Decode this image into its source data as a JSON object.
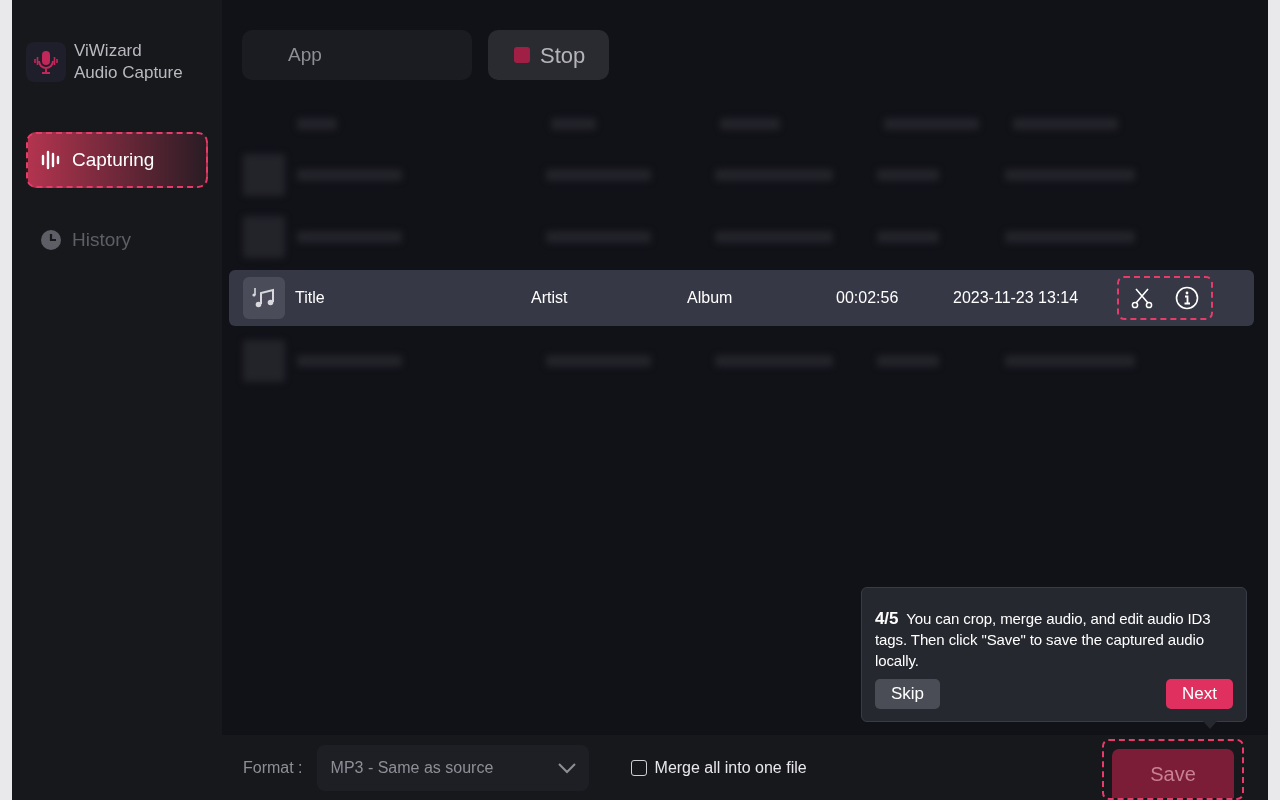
{
  "app": {
    "name_line1": "ViWizard",
    "name_line2": "Audio Capture"
  },
  "sidebar": {
    "items": [
      {
        "label": "Capturing",
        "kind": "bars",
        "selected": true,
        "highlighted": true
      },
      {
        "label": "History",
        "kind": "clock",
        "selected": false,
        "highlighted": false
      }
    ]
  },
  "toolbar": {
    "source": "App",
    "stop_button": "Stop"
  },
  "table": {
    "rows": [
      {
        "kind": "blurred"
      },
      {
        "kind": "blurred"
      },
      {
        "kind": "track",
        "title": "Title",
        "artist": "Artist",
        "album": "Album",
        "duration": "00:02:56",
        "date_added": "2023-11-23 13:14",
        "actions_highlighted": true
      },
      {
        "kind": "blurred"
      }
    ]
  },
  "tooltip": {
    "step": "4/5",
    "text": "You can crop, merge audio, and edit audio ID3 tags. Then click \"Save\" to save the captured audio locally.",
    "skip": "Skip",
    "next": "Next"
  },
  "footer": {
    "format_label": "Format :",
    "format_value": "MP3 - Same as source",
    "merge": {
      "label": "Merge all into one file",
      "checked": false
    },
    "save": "Save",
    "save_highlighted": true
  }
}
